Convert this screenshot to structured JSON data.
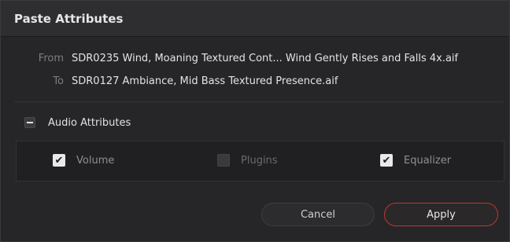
{
  "dialog": {
    "title": "Paste Attributes",
    "from_label": "From",
    "from_value": "SDR0235 Wind, Moaning Textured Cont... Wind Gently Rises and Falls 4x.aif",
    "to_label": "To",
    "to_value": "SDR0127 Ambiance, Mid Bass Textured Presence.aif",
    "section_title": "Audio Attributes",
    "attributes": [
      {
        "label": "Volume",
        "checked": true
      },
      {
        "label": "Plugins",
        "checked": false
      },
      {
        "label": "Equalizer",
        "checked": true
      }
    ],
    "cancel_label": "Cancel",
    "apply_label": "Apply",
    "accent_color": "#c0392b"
  }
}
